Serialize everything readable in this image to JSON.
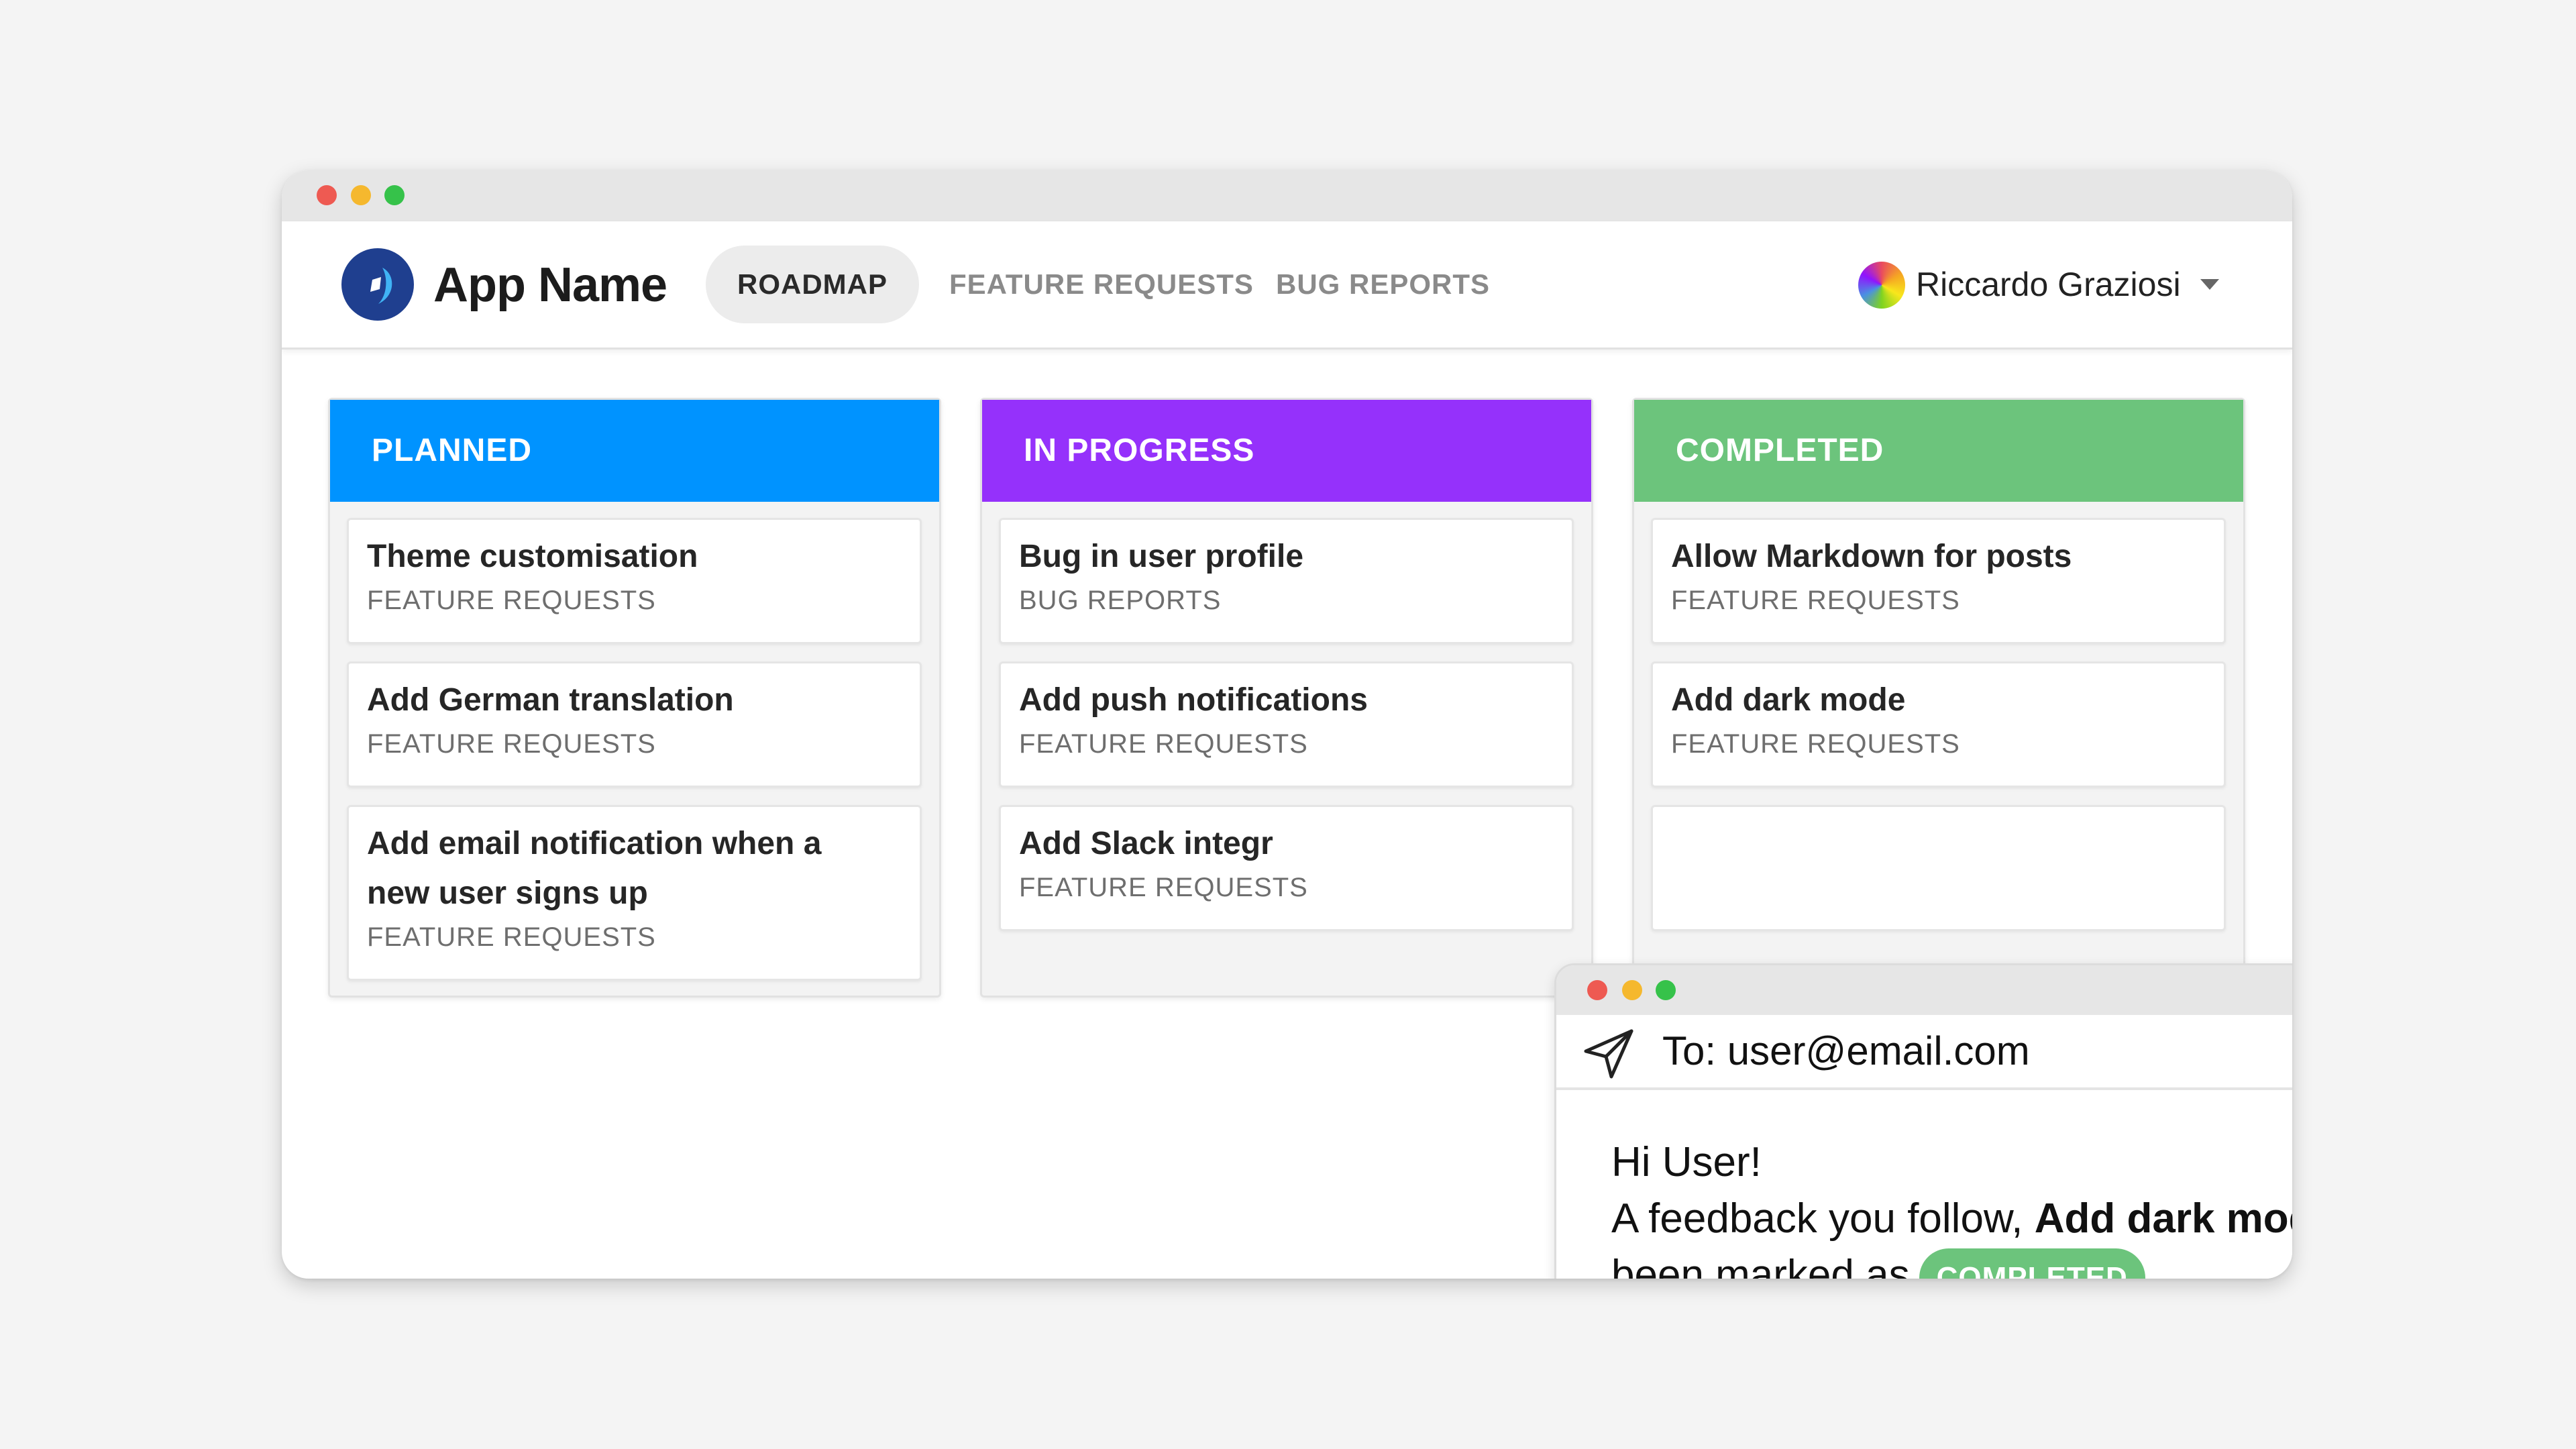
{
  "window": {
    "controls": [
      "close",
      "minimize",
      "maximize"
    ]
  },
  "header": {
    "app_name": "App Name",
    "logo_icon": "app-logo-icon",
    "nav": [
      {
        "label": "ROADMAP",
        "active": true
      },
      {
        "label": "FEATURE REQUESTS",
        "active": false
      },
      {
        "label": "BUG REPORTS",
        "active": false
      }
    ],
    "user": {
      "name": "Riccardo Graziosi",
      "avatar_icon": "avatar-icon",
      "menu_icon": "caret-down-icon"
    }
  },
  "board": {
    "columns": [
      {
        "title": "PLANNED",
        "color": "#0093ff",
        "cards": [
          {
            "title": "Theme customisation",
            "category": "FEATURE REQUESTS"
          },
          {
            "title": "Add German translation",
            "category": "FEATURE REQUESTS"
          },
          {
            "title": "Add email notification when a new user signs up",
            "category": "FEATURE REQUESTS"
          }
        ]
      },
      {
        "title": "IN PROGRESS",
        "color": "#9531fb",
        "cards": [
          {
            "title": "Bug in user profile",
            "category": "BUG REPORTS"
          },
          {
            "title": "Add push notifications",
            "category": "FEATURE REQUESTS"
          },
          {
            "title": "Add Slack integr",
            "category": "FEATURE REQUESTS"
          }
        ]
      },
      {
        "title": "COMPLETED",
        "color": "#6cc47c",
        "cards": [
          {
            "title": "Allow Markdown for posts",
            "category": "FEATURE REQUESTS"
          },
          {
            "title": "Add dark mode",
            "category": "FEATURE REQUESTS"
          }
        ]
      }
    ]
  },
  "email": {
    "to": "To: user@email.com",
    "send_icon": "send-icon",
    "greeting": "Hi User!",
    "body_prefix": "A feedback you follow, ",
    "post_title": "Add dark mode",
    "body_suffix": ", has been marked as",
    "status": "COMPLETED",
    "status_color": "#6cc47c"
  },
  "colors": {
    "close": "#ee5a52",
    "minimize": "#f5b82e",
    "maximize": "#36c24a"
  }
}
